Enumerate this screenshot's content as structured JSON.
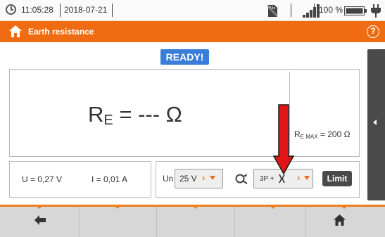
{
  "status_bar": {
    "time": "11:05:28",
    "date": "2018-07-21",
    "battery": "100 %",
    "icons": [
      "clock-icon",
      "sd-card-icon",
      "signal-icon",
      "battery-icon",
      "power-plug-icon"
    ]
  },
  "title_bar": {
    "title": "Earth resistance",
    "help": "?",
    "color": "#ef6c12"
  },
  "status_badge": "READY!",
  "result": {
    "symbol": "R",
    "subscript": "E",
    "equals_value": " = --- Ω",
    "max_symbol": "R",
    "max_subscript": "E MAX",
    "max_value": " = 200 Ω"
  },
  "measurements": {
    "voltage": "U = 0,27 V",
    "current": "I = 0,01 A"
  },
  "settings": {
    "un_label": "Un",
    "un_value": "25 V",
    "mode_value": "3P +",
    "limit_label": "Limit"
  },
  "bottom_bar": {
    "buttons": [
      "back-icon",
      "",
      "",
      "",
      "home-icon"
    ]
  },
  "colors": {
    "accent": "#ef6c12",
    "ready": "#3a7dd9",
    "annotation_arrow": "#e01515"
  }
}
